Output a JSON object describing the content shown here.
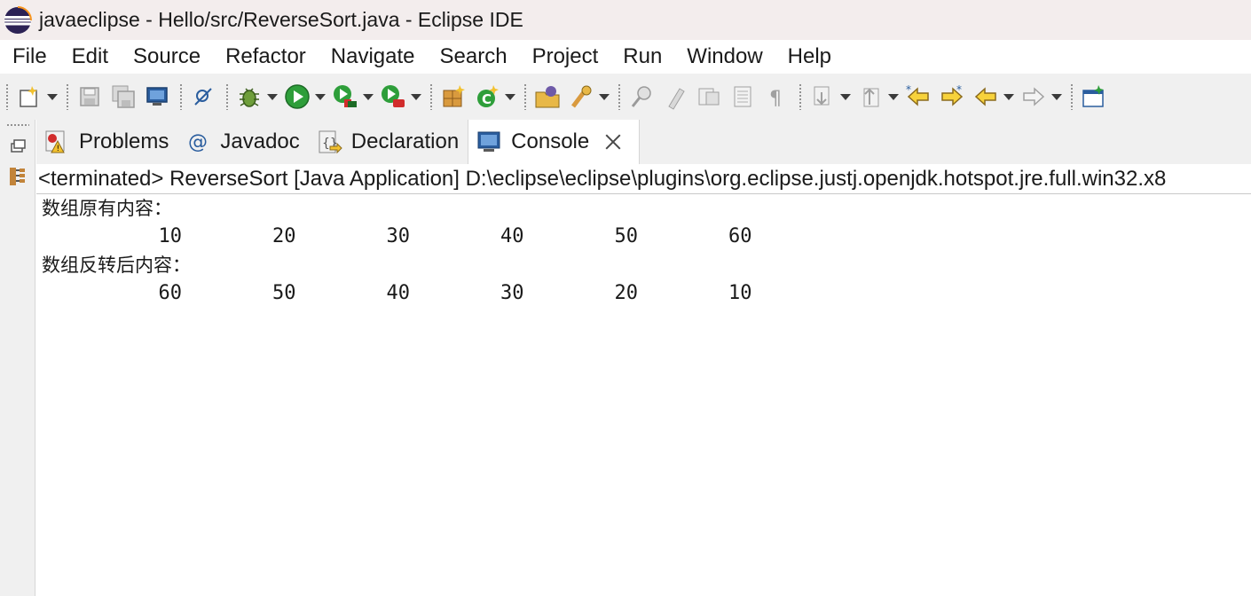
{
  "window": {
    "title": "javaeclipse - Hello/src/ReverseSort.java - Eclipse IDE"
  },
  "menu": {
    "items": [
      "File",
      "Edit",
      "Source",
      "Refactor",
      "Navigate",
      "Search",
      "Project",
      "Run",
      "Window",
      "Help"
    ]
  },
  "tabs": {
    "problems": "Problems",
    "javadoc": "Javadoc",
    "declaration": "Declaration",
    "console": "Console"
  },
  "console": {
    "header": "<terminated> ReverseSort [Java Application] D:\\eclipse\\eclipse\\plugins\\org.eclipse.justj.openjdk.hotspot.jre.full.win32.x8",
    "original_label": "数组原有内容：",
    "original_values": [
      "10",
      "20",
      "30",
      "40",
      "50",
      "60"
    ],
    "reversed_label": "数组反转后内容：",
    "reversed_values": [
      "60",
      "50",
      "40",
      "30",
      "20",
      "10"
    ]
  },
  "colors": {
    "titlebar_bg": "#f3eded",
    "toolbar_bg": "#f0f0f0",
    "run_green": "#2e9e3a",
    "console_blue": "#2a5d9e"
  }
}
